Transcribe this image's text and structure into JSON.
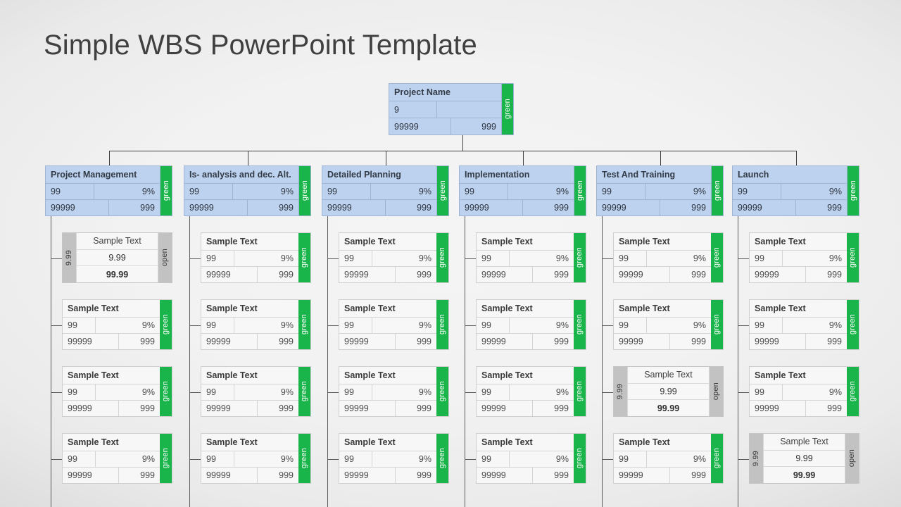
{
  "page": {
    "title": "Simple WBS PowerPoint Template"
  },
  "colors": {
    "node_blue": "#bdd2ee",
    "node_blue_border": "#9fb4d4",
    "status_green": "#19b44a",
    "status_gray": "#c2c2c2",
    "card_light": "#f7f7f7",
    "background": "#f2f2f2",
    "title_text": "#404040"
  },
  "labels": {
    "status_green": "green",
    "status_open": "open"
  },
  "root": {
    "title": "Project Name",
    "row1_left": "9",
    "row1_right": "",
    "row2_left": "99999",
    "row2_right": "999",
    "status": "green"
  },
  "columns": [
    {
      "header": {
        "title": "Project Management",
        "row1_left": "99",
        "row1_right": "9%",
        "row2_left": "99999",
        "row2_right": "999",
        "status": "green"
      },
      "children": [
        {
          "variant": "gray",
          "title": "Sample Text",
          "left_tag": "9.99",
          "right_tag": "open",
          "line1": "9.99",
          "line2": "99.99"
        },
        {
          "variant": "plain",
          "title": "Sample Text",
          "row1_left": "99",
          "row1_right": "9%",
          "row2_left": "99999",
          "row2_right": "999",
          "status": "green"
        },
        {
          "variant": "plain",
          "title": "Sample Text",
          "row1_left": "99",
          "row1_right": "9%",
          "row2_left": "99999",
          "row2_right": "999",
          "status": "green"
        },
        {
          "variant": "plain",
          "title": "Sample Text",
          "row1_left": "99",
          "row1_right": "9%",
          "row2_left": "99999",
          "row2_right": "999",
          "status": "green"
        }
      ]
    },
    {
      "header": {
        "title": "Is- analysis and dec. Alt.",
        "row1_left": "99",
        "row1_right": "9%",
        "row2_left": "99999",
        "row2_right": "999",
        "status": "green"
      },
      "children": [
        {
          "variant": "plain",
          "title": "Sample Text",
          "row1_left": "99",
          "row1_right": "9%",
          "row2_left": "99999",
          "row2_right": "999",
          "status": "green"
        },
        {
          "variant": "plain",
          "title": "Sample Text",
          "row1_left": "99",
          "row1_right": "9%",
          "row2_left": "99999",
          "row2_right": "999",
          "status": "green"
        },
        {
          "variant": "plain",
          "title": "Sample Text",
          "row1_left": "99",
          "row1_right": "9%",
          "row2_left": "99999",
          "row2_right": "999",
          "status": "green"
        },
        {
          "variant": "plain",
          "title": "Sample Text",
          "row1_left": "99",
          "row1_right": "9%",
          "row2_left": "99999",
          "row2_right": "999",
          "status": "green"
        }
      ]
    },
    {
      "header": {
        "title": "Detailed Planning",
        "row1_left": "99",
        "row1_right": "9%",
        "row2_left": "99999",
        "row2_right": "999",
        "status": "green"
      },
      "children": [
        {
          "variant": "plain",
          "title": "Sample Text",
          "row1_left": "99",
          "row1_right": "9%",
          "row2_left": "99999",
          "row2_right": "999",
          "status": "green"
        },
        {
          "variant": "plain",
          "title": "Sample Text",
          "row1_left": "99",
          "row1_right": "9%",
          "row2_left": "99999",
          "row2_right": "999",
          "status": "green"
        },
        {
          "variant": "plain",
          "title": "Sample Text",
          "row1_left": "99",
          "row1_right": "9%",
          "row2_left": "99999",
          "row2_right": "999",
          "status": "green"
        },
        {
          "variant": "plain",
          "title": "Sample Text",
          "row1_left": "99",
          "row1_right": "9%",
          "row2_left": "99999",
          "row2_right": "999",
          "status": "green"
        }
      ]
    },
    {
      "header": {
        "title": "Implementation",
        "row1_left": "99",
        "row1_right": "9%",
        "row2_left": "99999",
        "row2_right": "999",
        "status": "green"
      },
      "children": [
        {
          "variant": "plain",
          "title": "Sample Text",
          "row1_left": "99",
          "row1_right": "9%",
          "row2_left": "99999",
          "row2_right": "999",
          "status": "green"
        },
        {
          "variant": "plain",
          "title": "Sample Text",
          "row1_left": "99",
          "row1_right": "9%",
          "row2_left": "99999",
          "row2_right": "999",
          "status": "green"
        },
        {
          "variant": "plain",
          "title": "Sample Text",
          "row1_left": "99",
          "row1_right": "9%",
          "row2_left": "99999",
          "row2_right": "999",
          "status": "green"
        },
        {
          "variant": "plain",
          "title": "Sample Text",
          "row1_left": "99",
          "row1_right": "9%",
          "row2_left": "99999",
          "row2_right": "999",
          "status": "green"
        }
      ]
    },
    {
      "header": {
        "title": "Test And Training",
        "row1_left": "99",
        "row1_right": "9%",
        "row2_left": "99999",
        "row2_right": "999",
        "status": "green"
      },
      "children": [
        {
          "variant": "plain",
          "title": "Sample Text",
          "row1_left": "99",
          "row1_right": "9%",
          "row2_left": "99999",
          "row2_right": "999",
          "status": "green"
        },
        {
          "variant": "plain",
          "title": "Sample Text",
          "row1_left": "99",
          "row1_right": "9%",
          "row2_left": "99999",
          "row2_right": "999",
          "status": "green"
        },
        {
          "variant": "gray",
          "title": "Sample Text",
          "left_tag": "9.99",
          "right_tag": "open",
          "line1": "9.99",
          "line2": "99.99"
        },
        {
          "variant": "plain",
          "title": "Sample Text",
          "row1_left": "99",
          "row1_right": "9%",
          "row2_left": "99999",
          "row2_right": "999",
          "status": "green"
        }
      ]
    },
    {
      "header": {
        "title": "Launch",
        "row1_left": "99",
        "row1_right": "9%",
        "row2_left": "99999",
        "row2_right": "999",
        "status": "green"
      },
      "children": [
        {
          "variant": "plain",
          "title": "Sample Text",
          "row1_left": "99",
          "row1_right": "9%",
          "row2_left": "99999",
          "row2_right": "999",
          "status": "green"
        },
        {
          "variant": "plain",
          "title": "Sample Text",
          "row1_left": "99",
          "row1_right": "9%",
          "row2_left": "99999",
          "row2_right": "999",
          "status": "green"
        },
        {
          "variant": "plain",
          "title": "Sample Text",
          "row1_left": "99",
          "row1_right": "9%",
          "row2_left": "99999",
          "row2_right": "999",
          "status": "green"
        },
        {
          "variant": "gray",
          "title": "Sample Text",
          "left_tag": "9.99",
          "right_tag": "open",
          "line1": "9.99",
          "line2": "99.99"
        }
      ]
    }
  ]
}
